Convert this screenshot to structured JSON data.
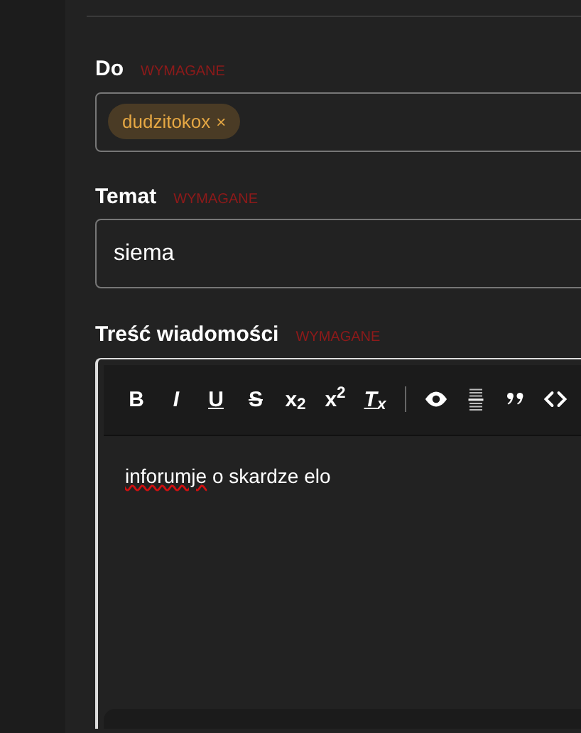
{
  "fields": [
    {
      "kind": "tags",
      "label": "Do",
      "required": "WYMAGANE",
      "tags": [
        {
          "text": "dudzitokox",
          "remove": "×"
        }
      ]
    },
    {
      "kind": "text",
      "label": "Temat",
      "required": "WYMAGANE",
      "value": "siema"
    },
    {
      "kind": "editor",
      "label": "Treść wiadomości",
      "required": "WYMAGANE",
      "toolbar": [
        {
          "kind": "text",
          "label": "B"
        },
        {
          "kind": "text",
          "label": "I"
        },
        {
          "kind": "text",
          "label": "U"
        },
        {
          "kind": "text",
          "label": "S"
        },
        {
          "kind": "text",
          "label": "x$_{2}$"
        },
        {
          "kind": "text",
          "label": "x$^{2}$"
        },
        {
          "kind": "text",
          "label": "T$_{x}$"
        },
        {
          "kind": "divider"
        },
        {
          "kind": "icon"
        },
        {
          "kind": "icon"
        },
        {
          "kind": "icon"
        },
        {
          "kind": "icon"
        }
      ],
      "body": [
        {
          "text": "inforumje",
          "misspelled": true
        },
        {
          "text": " o skardze elo",
          "misspelled": false
        }
      ]
    }
  ]
}
